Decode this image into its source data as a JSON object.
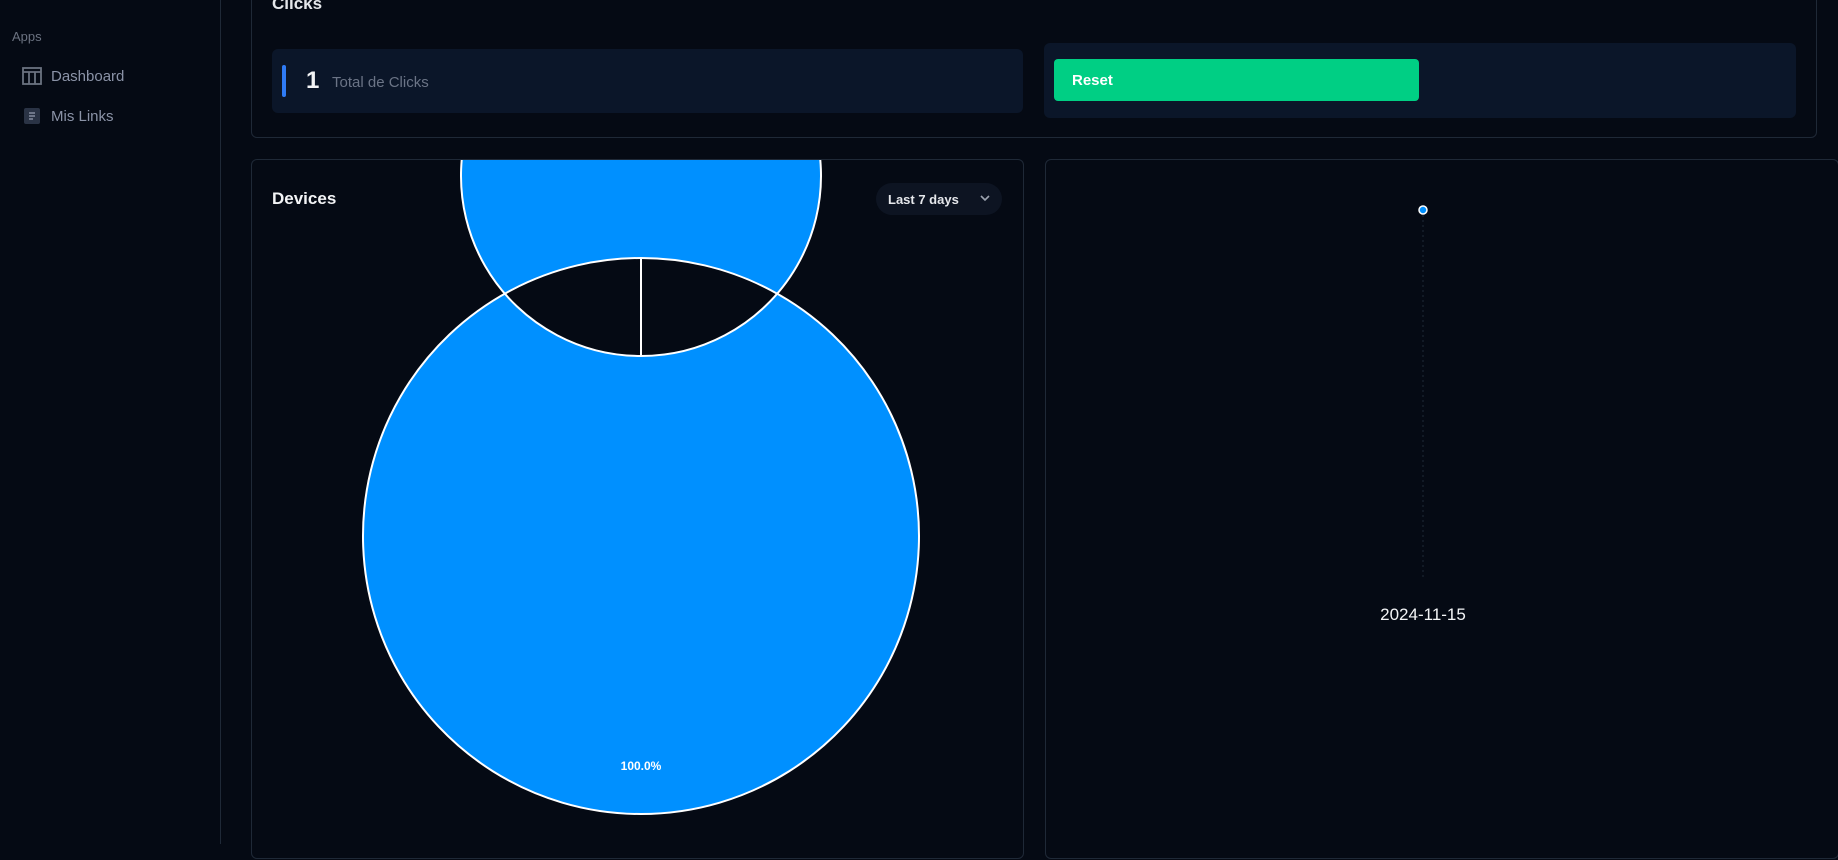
{
  "sidebar": {
    "section_title": "Apps",
    "items": [
      {
        "label": "Dashboard",
        "icon": "kanban-icon"
      },
      {
        "label": "Mis Links",
        "icon": "document-icon"
      }
    ]
  },
  "clicks": {
    "title": "Clicks",
    "total_value": "1",
    "total_label": "Total de Clicks",
    "reset_label": "Reset"
  },
  "devices": {
    "title": "Devices",
    "range_selected": "Last 7 days"
  },
  "colors": {
    "accent": "#0090ff",
    "reset": "#00cf84",
    "stat_bar": "#2f7bf5"
  },
  "chart_data": [
    {
      "type": "pie",
      "categories": [
        ""
      ],
      "values": [
        100
      ],
      "data_labels": [
        "100.0%"
      ]
    },
    {
      "type": "scatter",
      "x": [
        "2024-11-15"
      ],
      "y": [
        1
      ],
      "tick_labels": [
        "2024-11-15"
      ]
    }
  ]
}
